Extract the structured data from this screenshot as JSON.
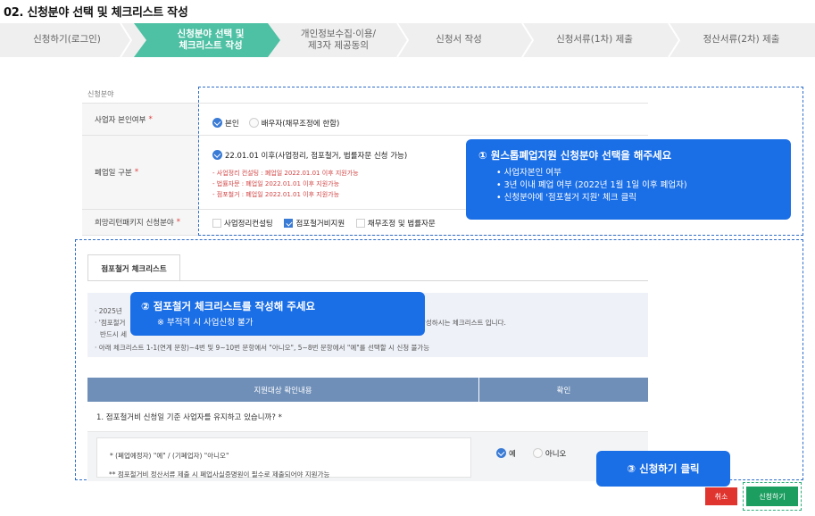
{
  "page_title": "02. 신청분야 선택 및 체크리스트 작성",
  "steps": [
    {
      "label": "신청하기(로그인)",
      "active": false
    },
    {
      "label": "신청분야 선택 및\n체크리스트 작성",
      "active": true
    },
    {
      "label": "개인정보수집·이용/\n제3자 제공동의",
      "active": false
    },
    {
      "label": "신청서 작성",
      "active": false
    },
    {
      "label": "신청서류(1차) 제출",
      "active": false
    },
    {
      "label": "정산서류(2차) 제출",
      "active": false
    }
  ],
  "form": {
    "section_label": "신청분야",
    "owner_row": {
      "label": "사업자 본인여부",
      "required": "*",
      "option_self": "본인",
      "option_spouse": "배우자(채무조정에 한함)"
    },
    "closure_row": {
      "label": "폐업일 구분",
      "required": "*",
      "option": "22.01.01 이후(사업정리, 점포철거, 법률자문 신청 가능)",
      "notes": [
        "- 사업정리 컨설팅 : 폐업일 2022.01.01 이후 지원가능",
        "- 법률자문 : 폐업일 2022.01.01 이후 지원가능",
        "- 점포철거 : 폐업일 2022.01.01 이후 지원가능"
      ]
    },
    "package_row": {
      "label": "희망리턴패키지 신청분야",
      "required": "*",
      "opt1": "사업정리컨설팅",
      "opt2": "점포철거비지원",
      "opt3": "채무조정 및 법률자문"
    }
  },
  "tip1": {
    "title": "① 원스톱폐업지원 신청분야 선택을 해주세요",
    "bullets": [
      "사업자본인 여부",
      "3년 이내 폐업 여부 (2022년 1월 1일 이후 폐업자)",
      "신청분야에 '점포철거 지원' 체크 클릭"
    ]
  },
  "checklist": {
    "tab": "점포철거 체크리스트",
    "info_line1": "· 2025년",
    "info_line2": "· '점포철거",
    "info_line2_end": "작성하시는 체크리스트 입니다.",
    "info_line3": "반드시 세",
    "info_line4": "· 아래 체크리스트 1-1(연계 문항)~4번 및 9~10번 문항에서 \"아니오\", 5~8번 문항에서 \"예\"를 선택할 시 신청 불가능",
    "col1": "지원대상 확인내용",
    "col2": "확인",
    "q1": "1. 점포철거비 신청일 기준 사업자를 유지하고 있습니까? *",
    "sub1": "* (폐업예정자) \"예\" / (기폐업자) \"아니오\"",
    "sub2": "** 점포철거비 정산서류 제출 시 폐업사실증명원이 필수로 제출되어야 지원가능",
    "yes": "예",
    "no": "아니오"
  },
  "tip2": {
    "title": "② 점포철거 체크리스트를 작성해 주세요",
    "sub": "※ 부적격 시 사업신청 불가"
  },
  "tip3": {
    "title": "③ 신청하기 클릭"
  },
  "buttons": {
    "cancel": "취소",
    "apply": "신청하기"
  },
  "colors": {
    "step_active": "#4ec0a3",
    "tip": "#1a6ee6",
    "table_head": "#6f8fb8",
    "apply": "#1b9e5f",
    "cancel": "#e0342f"
  }
}
